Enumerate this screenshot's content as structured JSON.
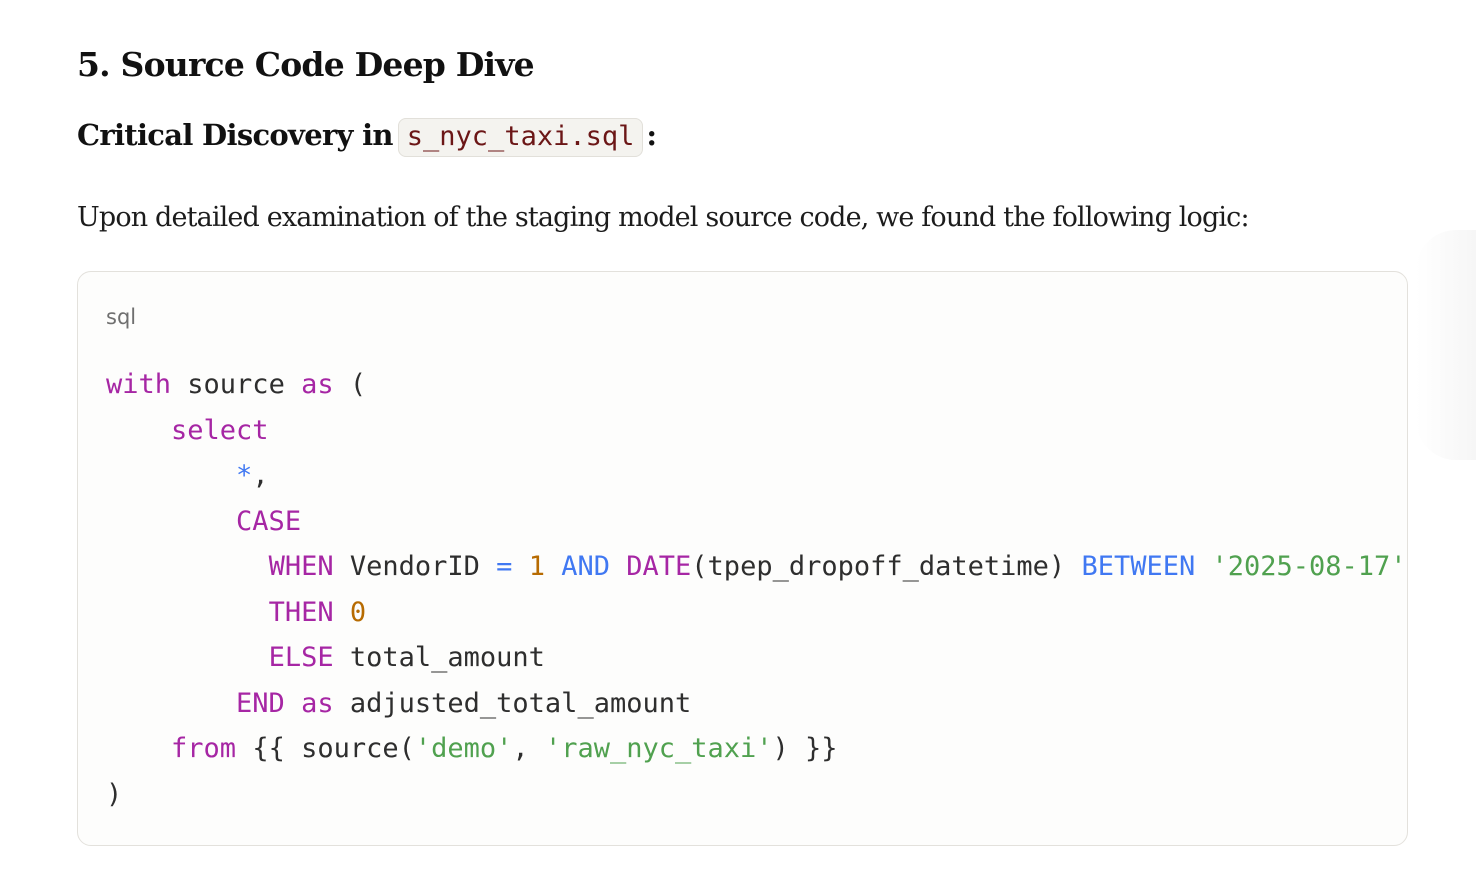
{
  "section": {
    "title": "5. Source Code Deep Dive"
  },
  "subheading": {
    "prefix": "Critical Discovery in",
    "code": "s_nyc_taxi.sql",
    "suffix": ":"
  },
  "paragraph": {
    "text": "Upon detailed examination of the staging model source code, we found the following logic:"
  },
  "code_block": {
    "language": "sql",
    "lines": [
      [
        {
          "t": "kw",
          "v": "with"
        },
        {
          "t": "plain",
          "v": " source "
        },
        {
          "t": "kw",
          "v": "as"
        },
        {
          "t": "plain",
          "v": " ("
        }
      ],
      [
        {
          "t": "plain",
          "v": "    "
        },
        {
          "t": "kw",
          "v": "select"
        }
      ],
      [
        {
          "t": "plain",
          "v": "        "
        },
        {
          "t": "kw2",
          "v": "*"
        },
        {
          "t": "plain",
          "v": ","
        }
      ],
      [
        {
          "t": "plain",
          "v": "        "
        },
        {
          "t": "kw",
          "v": "CASE"
        }
      ],
      [
        {
          "t": "plain",
          "v": "          "
        },
        {
          "t": "kw",
          "v": "WHEN"
        },
        {
          "t": "plain",
          "v": " VendorID "
        },
        {
          "t": "kw2",
          "v": "="
        },
        {
          "t": "plain",
          "v": " "
        },
        {
          "t": "num",
          "v": "1"
        },
        {
          "t": "plain",
          "v": " "
        },
        {
          "t": "kw2",
          "v": "AND"
        },
        {
          "t": "plain",
          "v": " "
        },
        {
          "t": "kw",
          "v": "DATE"
        },
        {
          "t": "plain",
          "v": "(tpep_dropoff_datetime) "
        },
        {
          "t": "kw2",
          "v": "BETWEEN"
        },
        {
          "t": "plain",
          "v": " "
        },
        {
          "t": "str",
          "v": "'2025-08-17'"
        }
      ],
      [
        {
          "t": "plain",
          "v": "          "
        },
        {
          "t": "kw",
          "v": "THEN"
        },
        {
          "t": "plain",
          "v": " "
        },
        {
          "t": "num",
          "v": "0"
        }
      ],
      [
        {
          "t": "plain",
          "v": "          "
        },
        {
          "t": "kw",
          "v": "ELSE"
        },
        {
          "t": "plain",
          "v": " total_amount"
        }
      ],
      [
        {
          "t": "plain",
          "v": "        "
        },
        {
          "t": "kw",
          "v": "END"
        },
        {
          "t": "plain",
          "v": " "
        },
        {
          "t": "kw",
          "v": "as"
        },
        {
          "t": "plain",
          "v": " adjusted_total_amount"
        }
      ],
      [
        {
          "t": "plain",
          "v": "    "
        },
        {
          "t": "kw",
          "v": "from"
        },
        {
          "t": "plain",
          "v": " {{ source("
        },
        {
          "t": "str",
          "v": "'demo'"
        },
        {
          "t": "plain",
          "v": ", "
        },
        {
          "t": "str",
          "v": "'raw_nyc_taxi'"
        },
        {
          "t": "plain",
          "v": ") }}"
        }
      ],
      [
        {
          "t": "plain",
          "v": ")"
        }
      ]
    ]
  },
  "colors": {
    "keyword": "#a626a4",
    "operator_keyword": "#4078f2",
    "number": "#b76b01",
    "string": "#50a14f",
    "inline_code_text": "#6b1616"
  }
}
